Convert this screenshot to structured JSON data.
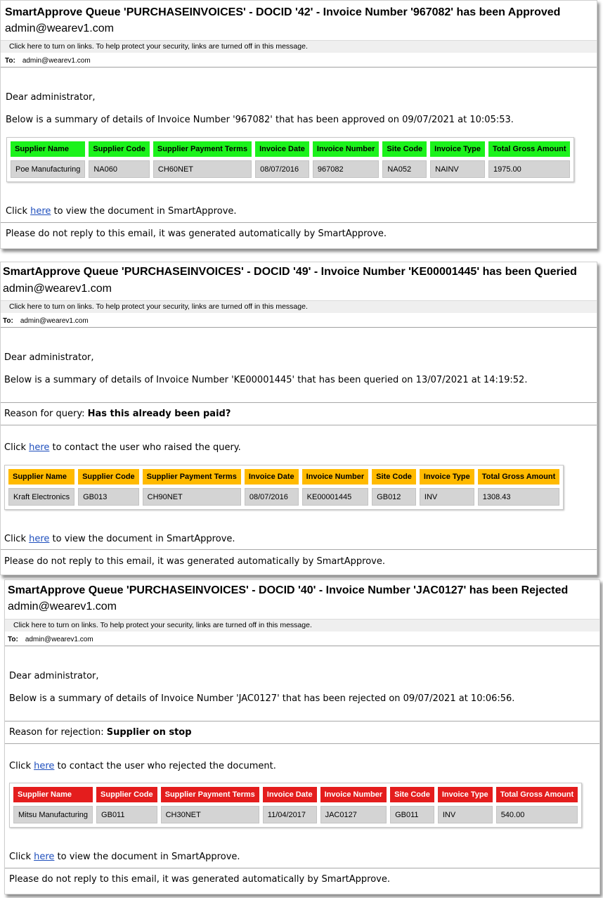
{
  "emails": [
    {
      "subject": "SmartApprove Queue 'PURCHASEINVOICES' - DOCID '42' - Invoice Number '967082' has been Approved",
      "from": "admin@wearev1.com",
      "infobar": "Click here to turn on links. To help protect your security, links are turned off in this message.",
      "to_label": "To:",
      "to_value": "admin@wearev1.com",
      "greeting": "Dear administrator,",
      "summary": "Below is a summary of details of Invoice Number '967082' that has been approved on 09/07/2021 at 10:05:53.",
      "header_color": "#1cf21c",
      "columns": [
        "Supplier Name",
        "Supplier Code",
        "Supplier Payment Terms",
        "Invoice Date",
        "Invoice Number",
        "Site Code",
        "Invoice Type",
        "Total Gross Amount"
      ],
      "row": [
        "Poe Manufacturing",
        "NA060",
        "CH60NET",
        "08/07/2016",
        "967082",
        "NA052",
        "NAINV",
        "1975.00"
      ],
      "view_prefix": "Click ",
      "view_link": "here",
      "view_suffix": " to view the document in SmartApprove.",
      "footer": "Please do not reply to this email, it was generated automatically by SmartApprove."
    },
    {
      "subject": "SmartApprove Queue 'PURCHASEINVOICES' - DOCID '49' - Invoice Number 'KE00001445' has been Queried",
      "from": "admin@wearev1.com",
      "infobar": "Click here to turn on links. To help protect your security, links are turned off in this message.",
      "to_label": "To:",
      "to_value": "admin@wearev1.com",
      "greeting": "Dear administrator,",
      "summary": "Below is a summary of details of Invoice Number 'KE00001445' that has been queried on 13/07/2021 at 14:19:52.",
      "reason_label": "Reason for query: ",
      "reason_value": "Has this already been paid?",
      "contact_prefix": "Click ",
      "contact_link": "here",
      "contact_suffix": " to contact the user who raised the query.",
      "header_color": "#ffba00",
      "columns": [
        "Supplier Name",
        "Supplier Code",
        "Supplier Payment Terms",
        "Invoice Date",
        "Invoice Number",
        "Site Code",
        "Invoice Type",
        "Total Gross Amount"
      ],
      "row": [
        "Kraft Electronics",
        "GB013",
        "CH90NET",
        "08/07/2016",
        "KE00001445",
        "GB012",
        "INV",
        "1308.43"
      ],
      "view_prefix": "Click ",
      "view_link": "here",
      "view_suffix": " to view the document in SmartApprove.",
      "footer": "Please do not reply to this email, it was generated automatically by SmartApprove."
    },
    {
      "subject": "SmartApprove Queue 'PURCHASEINVOICES' - DOCID '40' - Invoice Number 'JAC0127' has been Rejected",
      "from": "admin@wearev1.com",
      "infobar": "Click here to turn on links. To help protect your security, links are turned off in this message.",
      "to_label": "To:",
      "to_value": "admin@wearev1.com",
      "greeting": "Dear administrator,",
      "summary": "Below is a summary of details of Invoice Number 'JAC0127' that has been rejected on 09/07/2021 at 10:06:56.",
      "reason_label": "Reason for rejection: ",
      "reason_value": "Supplier on stop",
      "contact_prefix": "Click ",
      "contact_link": "here",
      "contact_suffix": " to contact the user who rejected the document.",
      "header_color": "#e41d1d",
      "columns": [
        "Supplier Name",
        "Supplier Code",
        "Supplier Payment Terms",
        "Invoice Date",
        "Invoice Number",
        "Site Code",
        "Invoice Type",
        "Total Gross Amount"
      ],
      "row": [
        "Mitsu Manufacturing",
        "GB011",
        "CH30NET",
        "11/04/2017",
        "JAC0127",
        "GB011",
        "INV",
        "540.00"
      ],
      "view_prefix": "Click ",
      "view_link": "here",
      "view_suffix": " to view the document in SmartApprove.",
      "footer": "Please do not reply to this email, it was generated automatically by SmartApprove."
    }
  ]
}
